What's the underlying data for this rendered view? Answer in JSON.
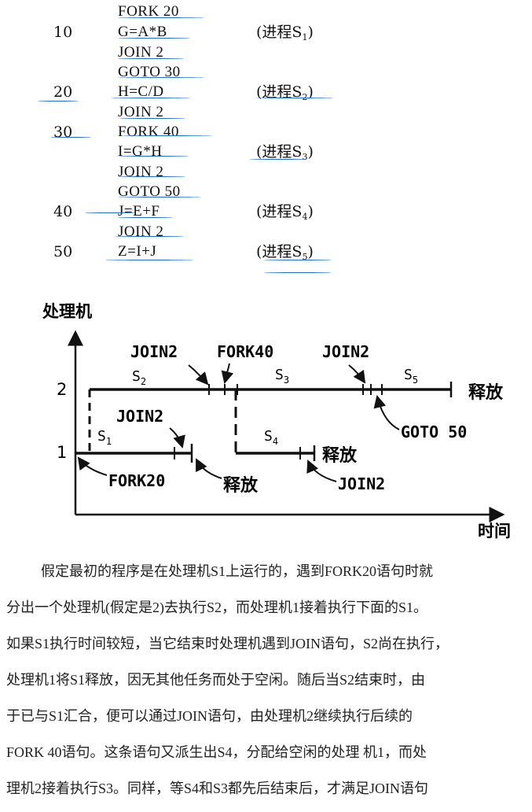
{
  "code": {
    "rows": [
      {
        "stmt": "FORK 20"
      },
      {
        "label": "10",
        "stmt": "G=A*B",
        "proc_text": "(进程S",
        "proc_sub": "1",
        "proc_close": ")"
      },
      {
        "stmt": "JOIN 2"
      },
      {
        "stmt": "GOTO 30"
      },
      {
        "label": "20",
        "stmt": "H=C/D",
        "proc_text": "(进程S",
        "proc_sub": "2",
        "proc_close": ")"
      },
      {
        "stmt": "JOIN 2"
      },
      {
        "label": "30",
        "stmt": "FORK 40"
      },
      {
        "stmt": "I=G*H",
        "proc_text": "(进程S",
        "proc_sub": "3",
        "proc_close": ")"
      },
      {
        "stmt": "JOIN 2"
      },
      {
        "stmt": "GOTO 50"
      },
      {
        "label": "40",
        "stmt": "J=E+F",
        "proc_text": "(进程S",
        "proc_sub": "4",
        "proc_close": ")"
      },
      {
        "stmt": "JOIN 2"
      },
      {
        "label": "50",
        "stmt": "Z=I+J",
        "proc_text": "(进程S",
        "proc_sub": "5",
        "proc_close": ")"
      }
    ]
  },
  "diagram": {
    "y_axis_label": "处理机",
    "x_axis_label": "时间",
    "levels": [
      "2",
      "1"
    ],
    "seg_labels": {
      "s1": "S",
      "s1_sub": "1",
      "s2": "S",
      "s2_sub": "2",
      "s3": "S",
      "s3_sub": "3",
      "s4": "S",
      "s4_sub": "4",
      "s5": "S",
      "s5_sub": "5"
    },
    "annotations": {
      "join2_top_left": "JOIN2",
      "fork40": "FORK40",
      "join2_top_right": "JOIN2",
      "goto50": "GOTO 50",
      "join2_mid": "JOIN2",
      "fork20": "FORK20",
      "release_1": "释放",
      "release_2": "释放",
      "release_3": "释放",
      "join2_bottom": "JOIN2"
    }
  },
  "paragraph": {
    "lines": [
      "假定最初的程序是在处理机S1上运行的，遇到FORK20语句时就",
      "分出一个处理机(假定是2)去执行S2，而处理机1接着执行下面的S1。",
      "如果S1执行时间较短，当它结束时处理机遇到JOIN语句，S2尚在执行，",
      "处理机1将S1释放，因无其他任务而处于空闲。随后当S2结束时，由",
      "于已与S1汇合，便可以通过JOIN语句，由处理机2继续执行后续的",
      "FORK 40语句。这条语句又派生出S4，分配给空闲的处理  机1，而处",
      "理机2接着执行S3。同样，等S4和S3都先后结束后，才满足JOIN语句"
    ]
  },
  "colors": {
    "ink": "#111111",
    "annotation_blue": "#1a6fd0"
  }
}
